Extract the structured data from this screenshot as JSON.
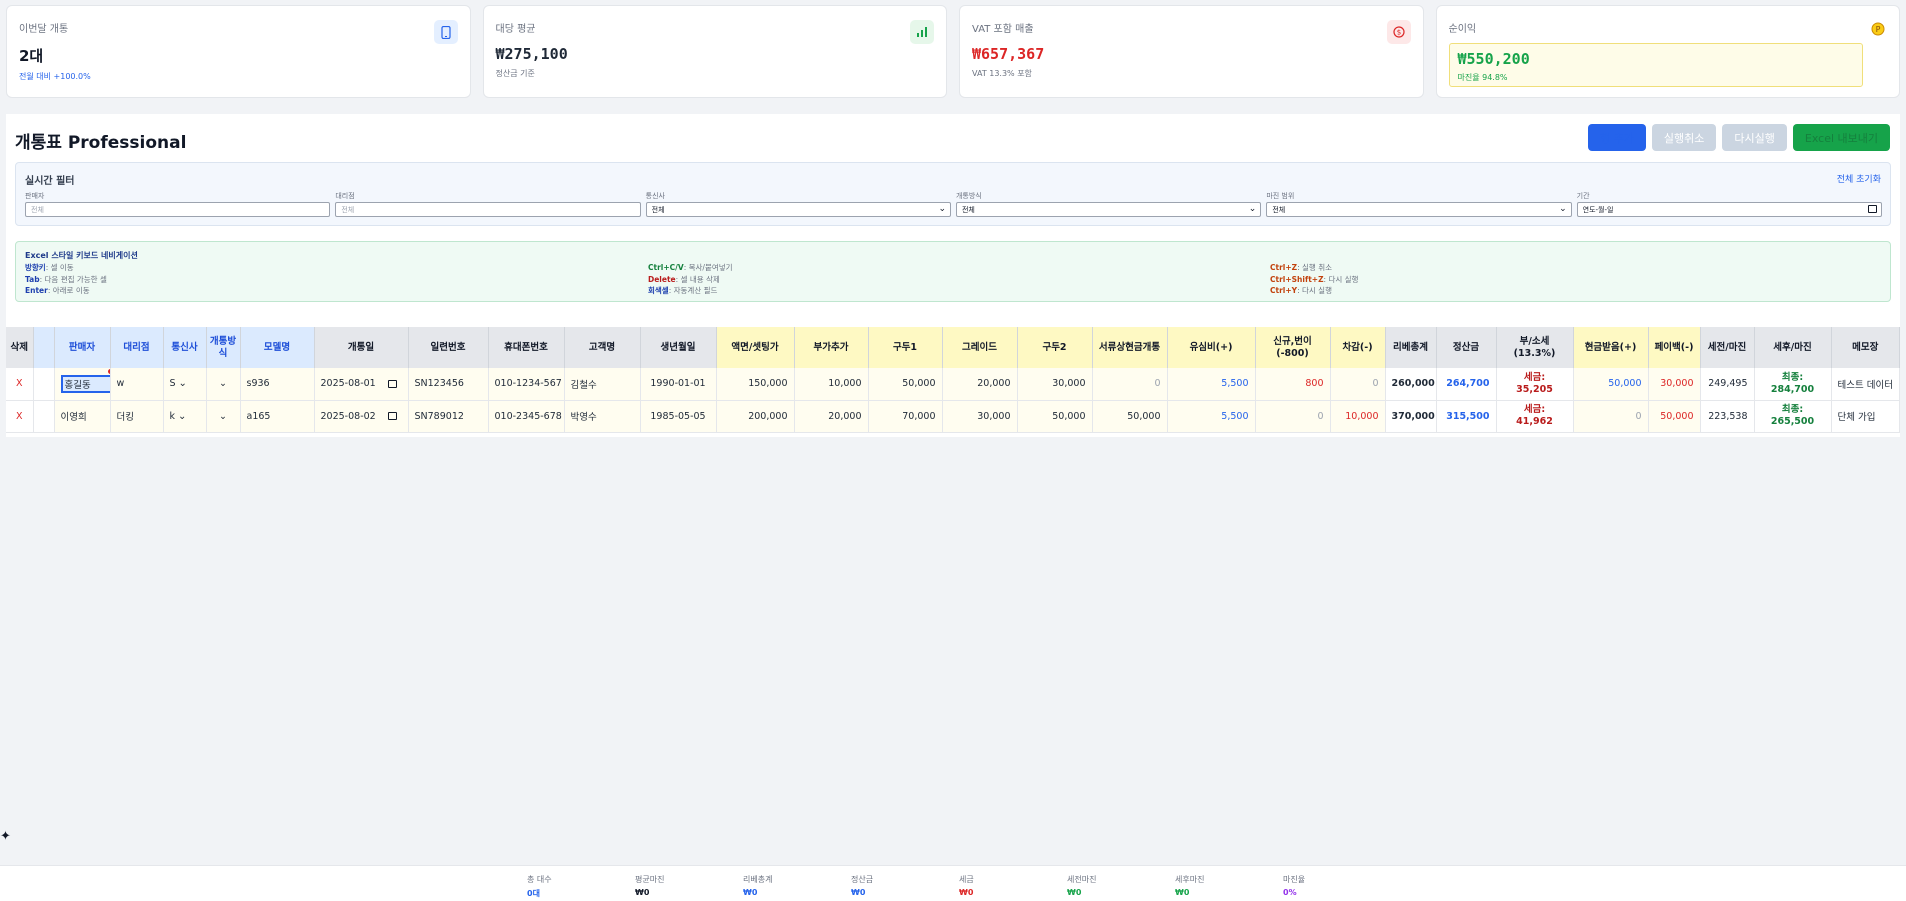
{
  "stats": {
    "units": {
      "label": "이번달 개통",
      "value": "2대",
      "sub": "전월 대비 +100.0%",
      "icon": "phone-icon"
    },
    "avg": {
      "label": "대당 평균",
      "value": "₩275,100",
      "sub": "정산금 기준",
      "icon": "bar-chart-icon"
    },
    "vat": {
      "label": "VAT 포함 매출",
      "value": "₩657,367",
      "sub": "VAT 13.3% 포함",
      "icon": "dollar-icon"
    },
    "profit": {
      "label": "순이익",
      "value": "₩550,200",
      "sub": "마진율 94.8%",
      "icon": "coin-icon"
    }
  },
  "panel": {
    "title": "개통표 Professional",
    "buttons": {
      "add_row": "행 추가",
      "undo": "실행취소",
      "redo": "다시실행",
      "export": "Excel 내보내기"
    }
  },
  "filters": {
    "title": "실시간 필터",
    "reset": "전체 초기화",
    "fields": [
      {
        "label": "판매자",
        "value": "전체"
      },
      {
        "label": "대리점",
        "value": "전체"
      },
      {
        "label": "통신사",
        "value": "전체"
      },
      {
        "label": "개통방식",
        "value": "전체"
      },
      {
        "label": "마진 범위",
        "value": "전체"
      },
      {
        "label": "기간",
        "value": "연도-월-일"
      }
    ]
  },
  "shortcuts": {
    "title": "Excel 스타일 키보드 네비게이션",
    "col1": [
      {
        "key": "방향키",
        "desc": ": 셀 이동"
      },
      {
        "key": "Tab",
        "desc": ": 다음 편집 가능한 셀"
      },
      {
        "key": "Enter",
        "desc": ": 아래로 이동"
      }
    ],
    "col2": [
      {
        "key": "Ctrl+C/V",
        "desc": ": 복사/붙여넣기"
      },
      {
        "key": "Delete",
        "desc": ": 셀 내용 삭제"
      },
      {
        "key": "회색셀",
        "desc": ": 자동계산 필드"
      }
    ],
    "col3": [
      {
        "key": "Ctrl+Z",
        "desc": ": 실행 취소"
      },
      {
        "key": "Ctrl+Shift+Z",
        "desc": ": 다시 실행"
      },
      {
        "key": "Ctrl+Y",
        "desc": ": 다시 실행"
      }
    ]
  },
  "table": {
    "headers": {
      "del": "삭제",
      "seller": "판매자",
      "agency": "대리점",
      "carrier": "통신사",
      "method": "개통방식",
      "model": "모델명",
      "date": "개통일",
      "serial": "일련번호",
      "phone": "휴대폰번호",
      "customer": "고객명",
      "birth": "생년월일",
      "price": "액면/셋팅가",
      "addon": "부가추가",
      "gudu1": "구두1",
      "grade": "그레이드",
      "gudu2": "구두2",
      "doc": "서류상현금개통",
      "usim": "유심비(+)",
      "newnum": "신규,번이(-800)",
      "deduct": "차감(-)",
      "rebate": "리베총계",
      "settle": "정산금",
      "vat": "부/소세 (13.3%)",
      "cash": "현금받음(+)",
      "payback": "페이백(-)",
      "pretax": "세전/마진",
      "posttax": "세후/마진",
      "memo": "메모장"
    },
    "rows": [
      {
        "del": "X",
        "seller": "홍길동",
        "agency": "w",
        "carrier": "S",
        "model": "s936",
        "date": "2025-08-01",
        "serial": "SN123456",
        "phone": "010-1234-567",
        "customer": "김철수",
        "birth": "1990-01-01",
        "price": "150,000",
        "addon": "10,000",
        "gudu1": "50,000",
        "grade": "20,000",
        "gudu2": "30,000",
        "doc": "0",
        "usim": "5,500",
        "newnum": "800",
        "deduct": "0",
        "rebate": "260,000",
        "settle": "264,700",
        "tax_label": "세금:",
        "tax": "35,205",
        "cash": "50,000",
        "payback": "30,000",
        "pretax": "249,495",
        "final_label": "최종:",
        "final": "284,700",
        "memo": "테스트 데이터"
      },
      {
        "del": "X",
        "seller": "이영희",
        "agency": "더킹",
        "carrier": "k",
        "model": "a165",
        "date": "2025-08-02",
        "serial": "SN789012",
        "phone": "010-2345-678",
        "customer": "박영수",
        "birth": "1985-05-05",
        "price": "200,000",
        "addon": "20,000",
        "gudu1": "70,000",
        "grade": "30,000",
        "gudu2": "50,000",
        "doc": "50,000",
        "usim": "5,500",
        "newnum": "0",
        "deduct": "10,000",
        "rebate": "370,000",
        "settle": "315,500",
        "tax_label": "세금:",
        "tax": "41,962",
        "cash": "0",
        "payback": "50,000",
        "pretax": "223,538",
        "final_label": "최종:",
        "final": "265,500",
        "memo": "단체 가입"
      }
    ]
  },
  "footer": [
    {
      "label": "총 대수",
      "value": "0대",
      "color": "#2563eb"
    },
    {
      "label": "평균마진",
      "value": "₩0",
      "color": "#111827"
    },
    {
      "label": "리베총계",
      "value": "₩0",
      "color": "#2563eb"
    },
    {
      "label": "정산금",
      "value": "₩0",
      "color": "#2563eb"
    },
    {
      "label": "세금",
      "value": "₩0",
      "color": "#dc2626"
    },
    {
      "label": "세전마진",
      "value": "₩0",
      "color": "#16a34a"
    },
    {
      "label": "세후마진",
      "value": "₩0",
      "color": "#16a34a"
    },
    {
      "label": "마진율",
      "value": "0%",
      "color": "#9333ea"
    }
  ],
  "colors": {
    "accent": "#2563eb",
    "success": "#16a34a",
    "danger": "#dc2626",
    "muted": "#cbd5e1"
  }
}
